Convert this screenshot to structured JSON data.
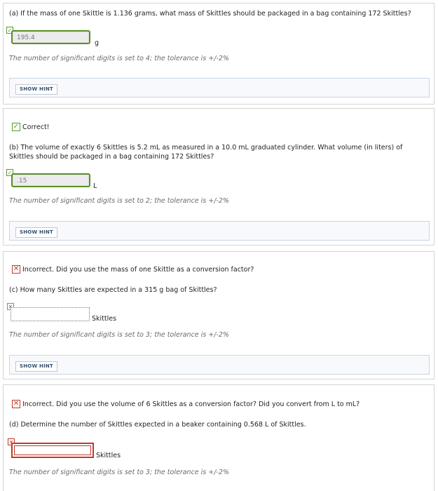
{
  "part_a": {
    "question": "(a) If the mass of one Skittle is 1.136 grams, what mass of Skittles should be packaged in a bag containing 172 Skittles?",
    "answer_value": "195.4",
    "unit": "g",
    "sig_text": "The number of significant digits is set to 4; the tolerance is +/-2%",
    "hint_label": "SHOW HINT"
  },
  "part_b": {
    "status": "Correct!",
    "question": "(b) The volume of exactly 6 Skittles is 5.2 mL as measured in a 10.0 mL graduated cylinder. What volume (in liters) of Skittles should be packaged in a bag containing 172 Skittles?",
    "answer_value": ".15",
    "unit": "L",
    "sig_text": "The number of significant digits is set to 2; the tolerance is +/-2%",
    "hint_label": "SHOW HINT"
  },
  "part_c": {
    "status": "Incorrect. Did you use the mass of one Skittle as a conversion factor?",
    "question": "(c) How many Skittles are expected in a 315 g bag of Skittles?",
    "answer_value": "",
    "unit": "Skittles",
    "sig_text": "The number of significant digits is set to 3; the tolerance is +/-2%",
    "hint_label": "SHOW HINT"
  },
  "part_d": {
    "status": "Incorrect. Did you use the volume of 6 Skittles as a conversion factor? Did you convert from L to mL?",
    "question": "(d) Determine the number of Skittles expected in a beaker containing 0.568 L of Skittles.",
    "answer_value": "",
    "unit": "Skittles",
    "sig_text": "The number of significant digits is set to 3; the tolerance is +/-2%"
  },
  "colors": {
    "correct": "#5b9a2e",
    "incorrect": "#c0392b",
    "hint_bg": "#f7f9fc"
  },
  "icons": {
    "correct": "check-icon",
    "incorrect": "x-icon"
  }
}
